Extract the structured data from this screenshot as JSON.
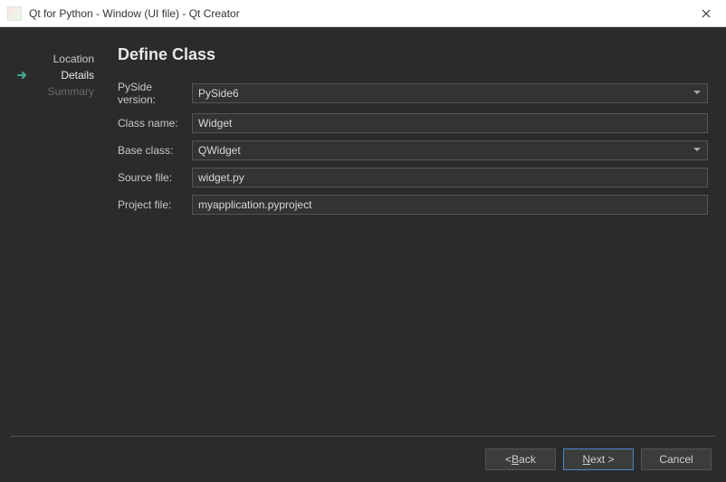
{
  "title": "Qt for Python - Window (UI file) - Qt Creator",
  "sidebar": {
    "items": [
      {
        "label": "Location",
        "state": "done"
      },
      {
        "label": "Details",
        "state": "active"
      },
      {
        "label": "Summary",
        "state": "disabled"
      }
    ]
  },
  "heading": "Define Class",
  "form": {
    "pyside_label": "PySide version:",
    "pyside_value": "PySide6",
    "class_label": "Class name:",
    "class_value": "Widget",
    "base_label": "Base class:",
    "base_value": "QWidget",
    "source_label": "Source file:",
    "source_value": "widget.py",
    "project_label": "Project file:",
    "project_value": "myapplication.pyproject"
  },
  "buttons": {
    "back_pre": "< ",
    "back_mn": "B",
    "back_post": "ack",
    "next_mn": "N",
    "next_post": "ext >",
    "cancel": "Cancel"
  }
}
